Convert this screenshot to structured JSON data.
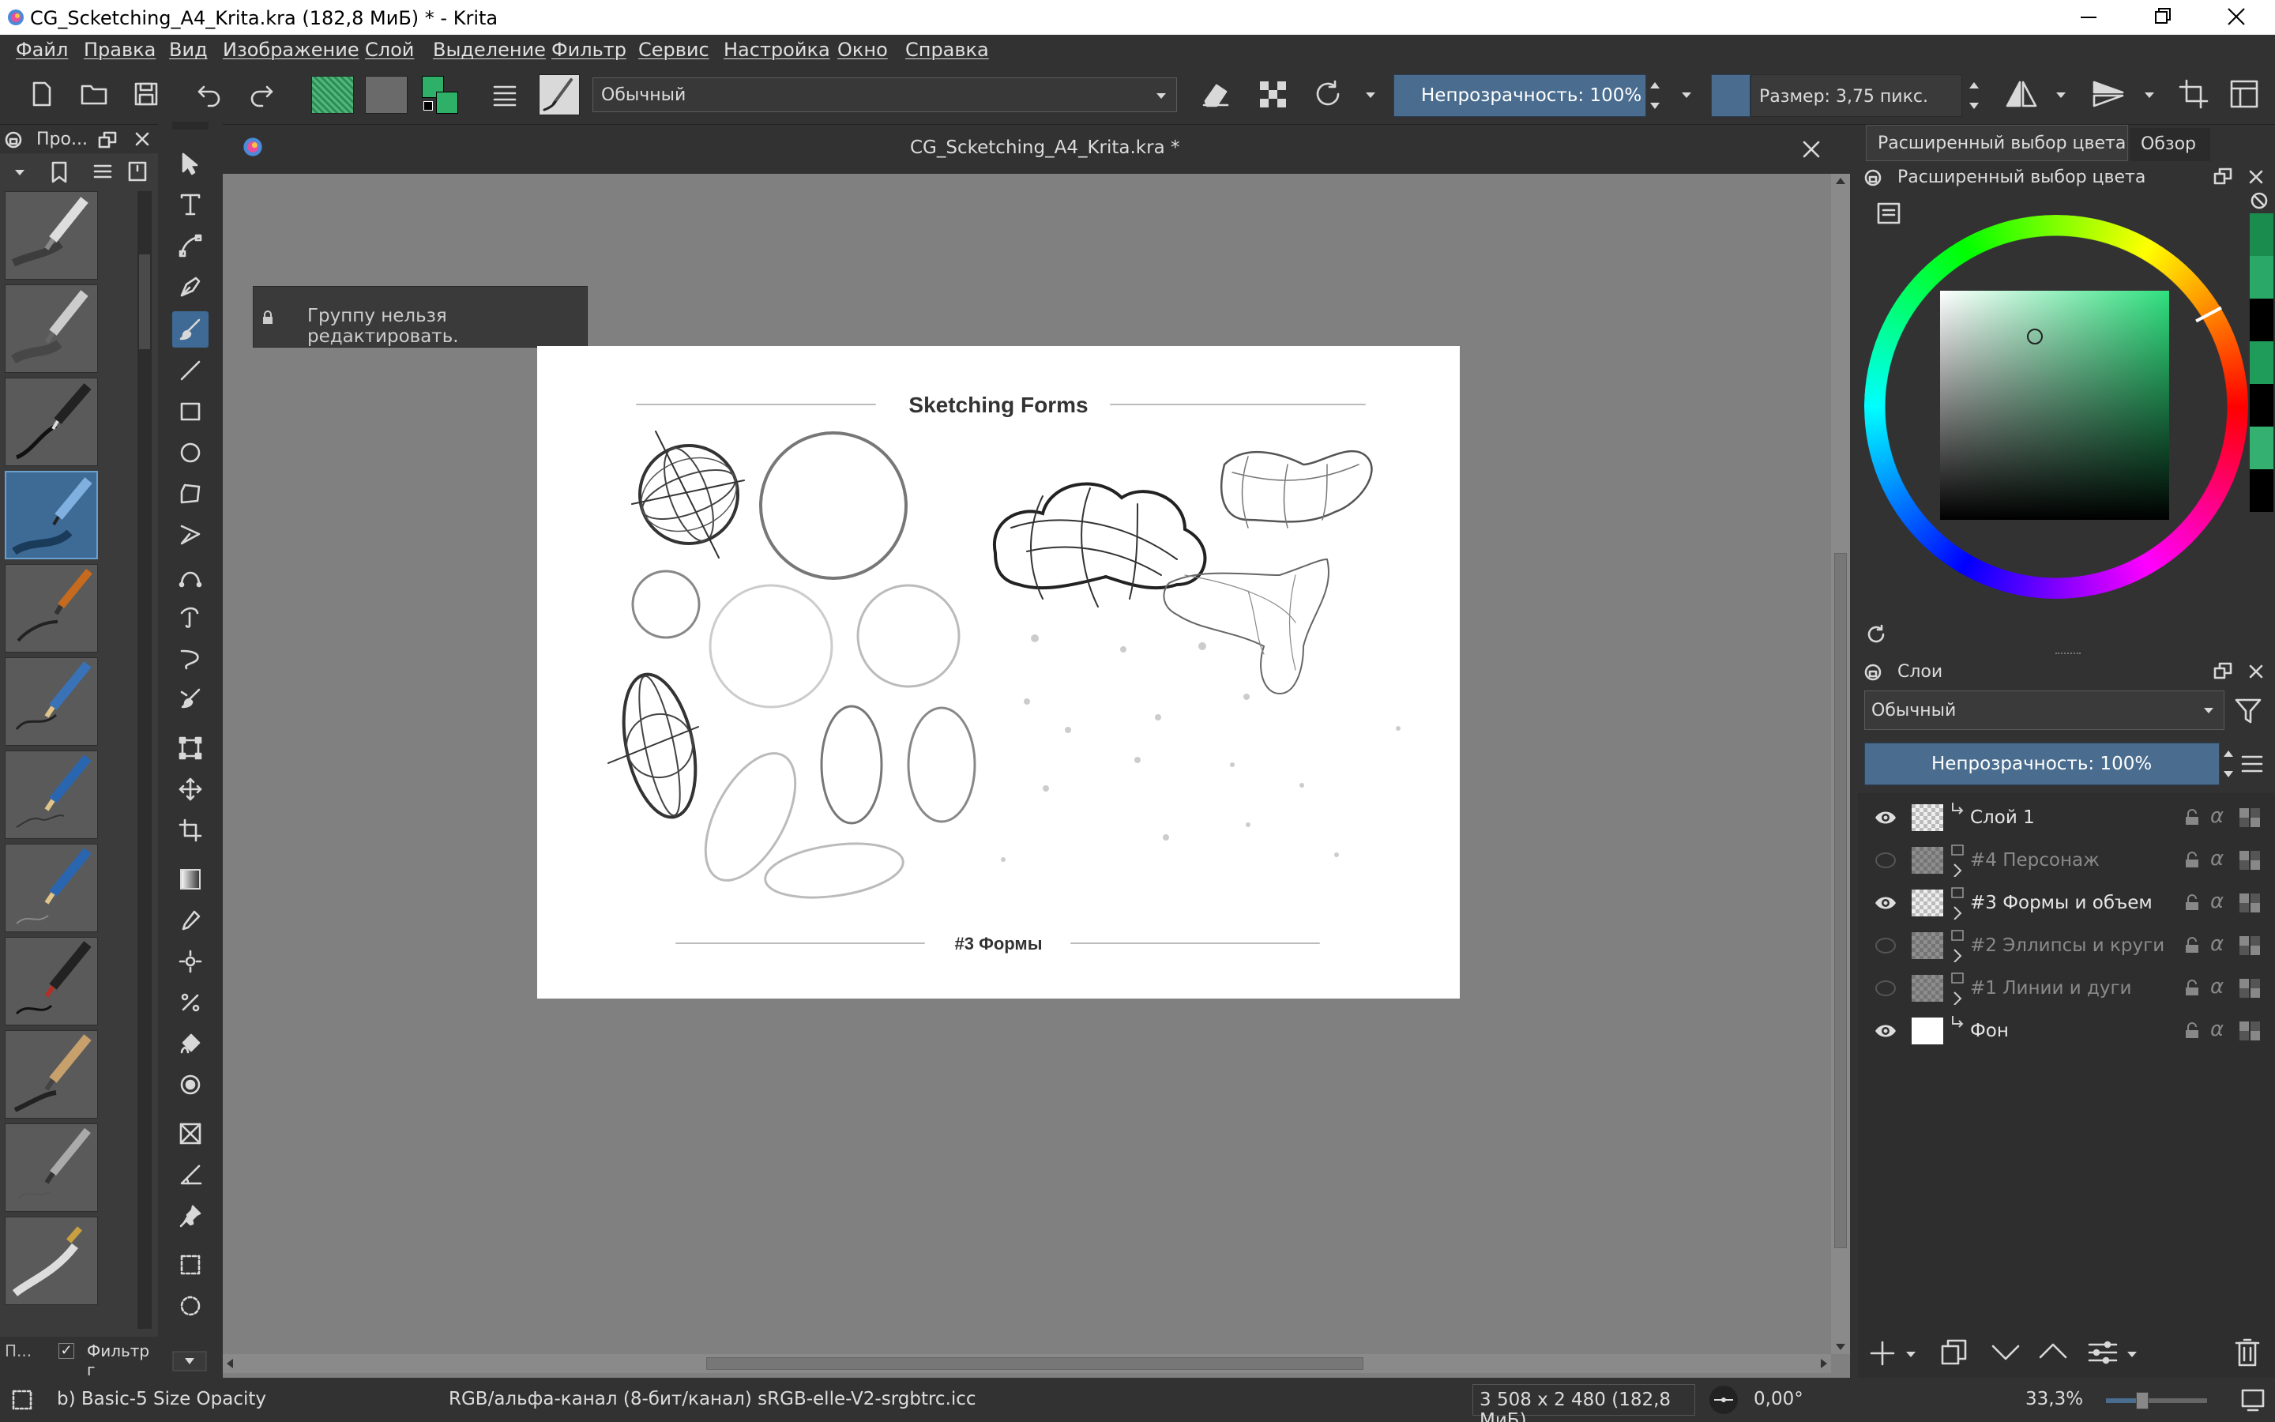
{
  "window": {
    "title": "CG_Scketching_A4_Krita.kra (182,8 МиБ)  * - Krita"
  },
  "menu": [
    "Файл",
    "Правка",
    "Вид",
    "Изображение",
    "Слой",
    "Выделение",
    "Фильтр",
    "Сервис",
    "Настройка",
    "Окно",
    "Справка"
  ],
  "toolbar": {
    "blend_mode": "Обычный",
    "opacity": "Непрозрачность: 100%",
    "size": "Размер: 3,75 пикс.",
    "fg_color": "#2fb068",
    "pattern_color": "#5da67a"
  },
  "brush_docker": {
    "title": "Про...",
    "filter_tab": "П...",
    "filter_label": "Фильтр г"
  },
  "document": {
    "tab_title": "CG_Scketching_A4_Krita.kra *",
    "locked_msg": "Группу нельзя редактировать."
  },
  "canvas": {
    "heading": "Sketching Forms",
    "footer": "#3 Формы"
  },
  "color_docker": {
    "tabs": [
      "Расширенный выбор цвета",
      "Обзор"
    ],
    "title": "Расширенный выбор цвета",
    "swatches": [
      "#1a8c4e",
      "#2aa868",
      "#000000",
      "#1f9c5a",
      "#000000",
      "#34b070",
      "#000000"
    ]
  },
  "layers_docker": {
    "title": "Слои",
    "blend_mode": "Обычный",
    "opacity": "Непрозрачность:  100%",
    "layers": [
      {
        "name": "Слой 1",
        "visible": true,
        "group": false,
        "thumb": "checker"
      },
      {
        "name": "#4 Персонаж",
        "visible": false,
        "group": true,
        "thumb": "checker"
      },
      {
        "name": "#3 Формы и объем",
        "visible": true,
        "group": true,
        "thumb": "checker"
      },
      {
        "name": "#2 Эллипсы и круги",
        "visible": false,
        "group": true,
        "thumb": "checker"
      },
      {
        "name": "#1 Линии и дуги",
        "visible": false,
        "group": true,
        "thumb": "checker"
      },
      {
        "name": "Фон",
        "visible": true,
        "group": false,
        "thumb": "white"
      }
    ]
  },
  "status": {
    "brush": "b) Basic-5 Size Opacity",
    "colorspace": "RGB/альфа-канал (8-бит/канал)  sRGB-elle-V2-srgbtrc.icc",
    "dimensions": "3 508 x 2 480 (182,8 МиБ)",
    "rotation": "0,00°",
    "zoom": "33,3%"
  }
}
